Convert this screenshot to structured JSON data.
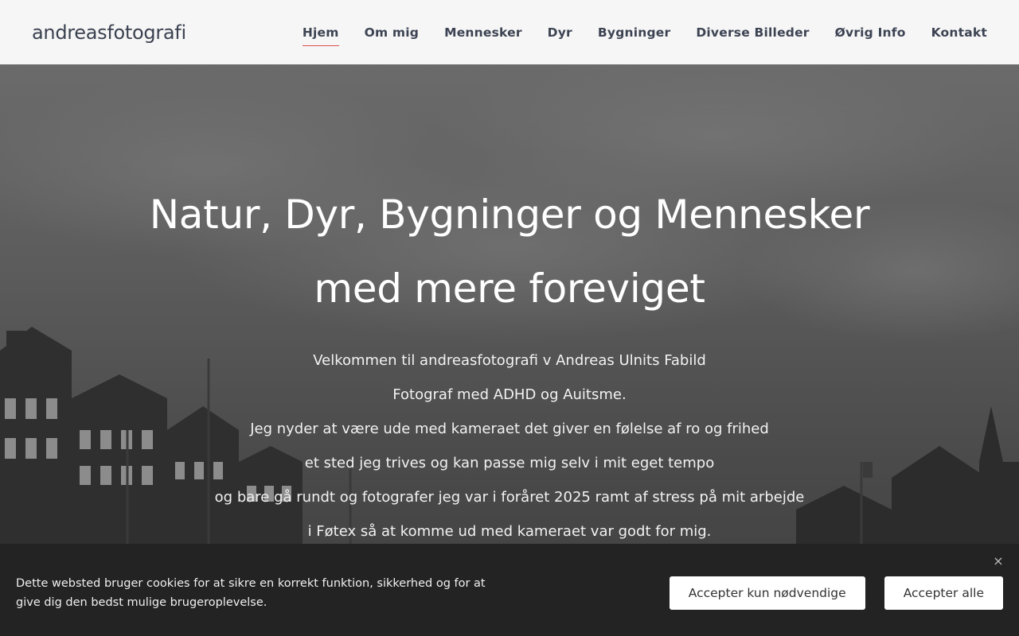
{
  "header": {
    "brand": "andreasfotografi",
    "nav": [
      {
        "label": "Hjem",
        "active": true
      },
      {
        "label": "Om mig"
      },
      {
        "label": "Mennesker"
      },
      {
        "label": "Dyr"
      },
      {
        "label": "Bygninger"
      },
      {
        "label": "Diverse Billeder"
      },
      {
        "label": "Øvrig Info"
      },
      {
        "label": "Kontakt"
      }
    ]
  },
  "hero": {
    "title_line1": "Natur, Dyr, Bygninger og Mennesker",
    "title_line2": "med mere foreviget",
    "lines": [
      "Velkommen til andreasfotografi v Andreas Ulnits Fabild",
      "Fotograf med ADHD og Auitsme.",
      "Jeg nyder at være ude med kameraet det giver en følelse af ro og frihed",
      "et sted jeg trives og kan passe mig selv i mit eget tempo",
      "og bare gå rundt og fotografer jeg var i foråret 2025 ramt af stress på mit arbejde",
      "i Føtex så at komme ud med kameraet var godt for mig."
    ]
  },
  "cookie": {
    "text": "Dette websted bruger cookies for at sikre en korrekt funktion, sikkerhed og for at give dig den bedst mulige brugeroplevelse.",
    "btn_necessary": "Accepter kun nødvendige",
    "btn_all": "Accepter alle",
    "close_icon": "×"
  },
  "colors": {
    "nav_active_underline": "#d9534f",
    "cookie_bg": "#232323"
  }
}
